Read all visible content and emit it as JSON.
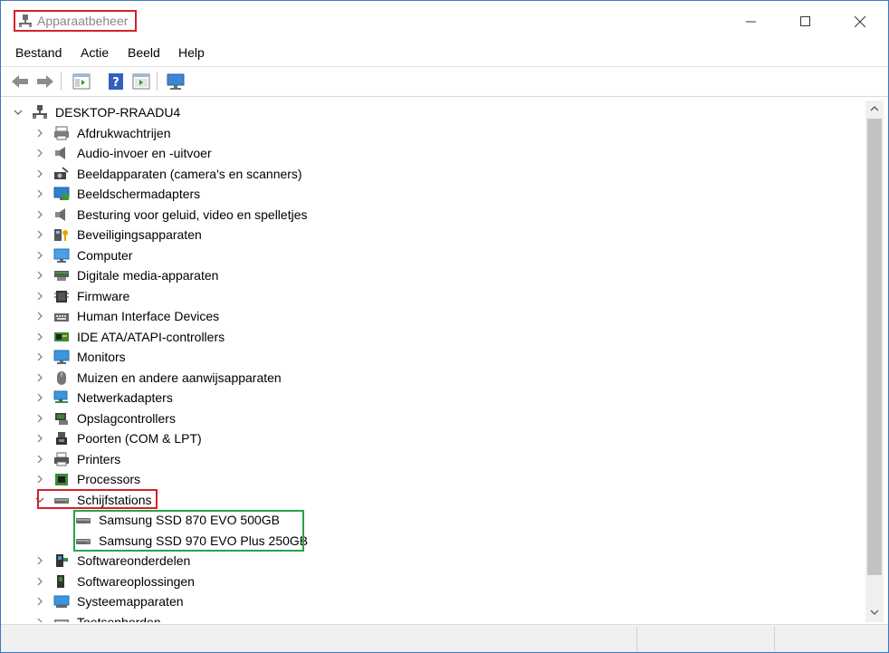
{
  "window": {
    "title": "Apparaatbeheer",
    "controls": [
      "minimize-icon",
      "maximize-icon",
      "close-icon"
    ]
  },
  "menu": [
    "Bestand",
    "Actie",
    "Beeld",
    "Help"
  ],
  "toolbar": [
    "back-arrow-icon",
    "forward-arrow-icon",
    "properties-icon",
    "help-icon",
    "view-icon",
    "scan-monitor-icon"
  ],
  "tree": {
    "root": "DESKTOP-RRAADU4",
    "categories": [
      {
        "label": "Afdrukwachtrijen",
        "icon": "printer-queue-icon"
      },
      {
        "label": "Audio-invoer en -uitvoer",
        "icon": "speaker-icon"
      },
      {
        "label": "Beeldapparaten (camera's en scanners)",
        "icon": "camera-icon"
      },
      {
        "label": "Beeldschermadapters",
        "icon": "display-adapter-icon"
      },
      {
        "label": "Besturing voor geluid, video en spelletjes",
        "icon": "speaker-icon"
      },
      {
        "label": "Beveiligingsapparaten",
        "icon": "security-key-icon"
      },
      {
        "label": "Computer",
        "icon": "computer-monitor-icon"
      },
      {
        "label": "Digitale media-apparaten",
        "icon": "media-device-icon"
      },
      {
        "label": "Firmware",
        "icon": "chip-icon"
      },
      {
        "label": "Human Interface Devices",
        "icon": "hid-keyboard-icon"
      },
      {
        "label": "IDE ATA/ATAPI-controllers",
        "icon": "ide-controller-icon"
      },
      {
        "label": "Monitors",
        "icon": "monitor-icon"
      },
      {
        "label": "Muizen en andere aanwijsapparaten",
        "icon": "mouse-icon"
      },
      {
        "label": "Netwerkadapters",
        "icon": "network-icon"
      },
      {
        "label": "Opslagcontrollers",
        "icon": "storage-controller-icon"
      },
      {
        "label": "Poorten (COM & LPT)",
        "icon": "port-icon"
      },
      {
        "label": "Printers",
        "icon": "printer-icon"
      },
      {
        "label": "Processors",
        "icon": "processor-icon"
      },
      {
        "label": "Schijfstations",
        "icon": "disk-drive-icon",
        "expanded": true
      },
      {
        "label": "Softwareonderdelen",
        "icon": "software-component-icon"
      },
      {
        "label": "Softwareoplossingen",
        "icon": "software-solution-icon"
      },
      {
        "label": "Systeemapparaten",
        "icon": "system-device-icon"
      },
      {
        "label": "Toetsenborden",
        "icon": "keyboard-icon"
      }
    ],
    "disk_drives": [
      "Samsung SSD 870 EVO 500GB",
      "Samsung SSD 970 EVO Plus 250GB"
    ]
  }
}
